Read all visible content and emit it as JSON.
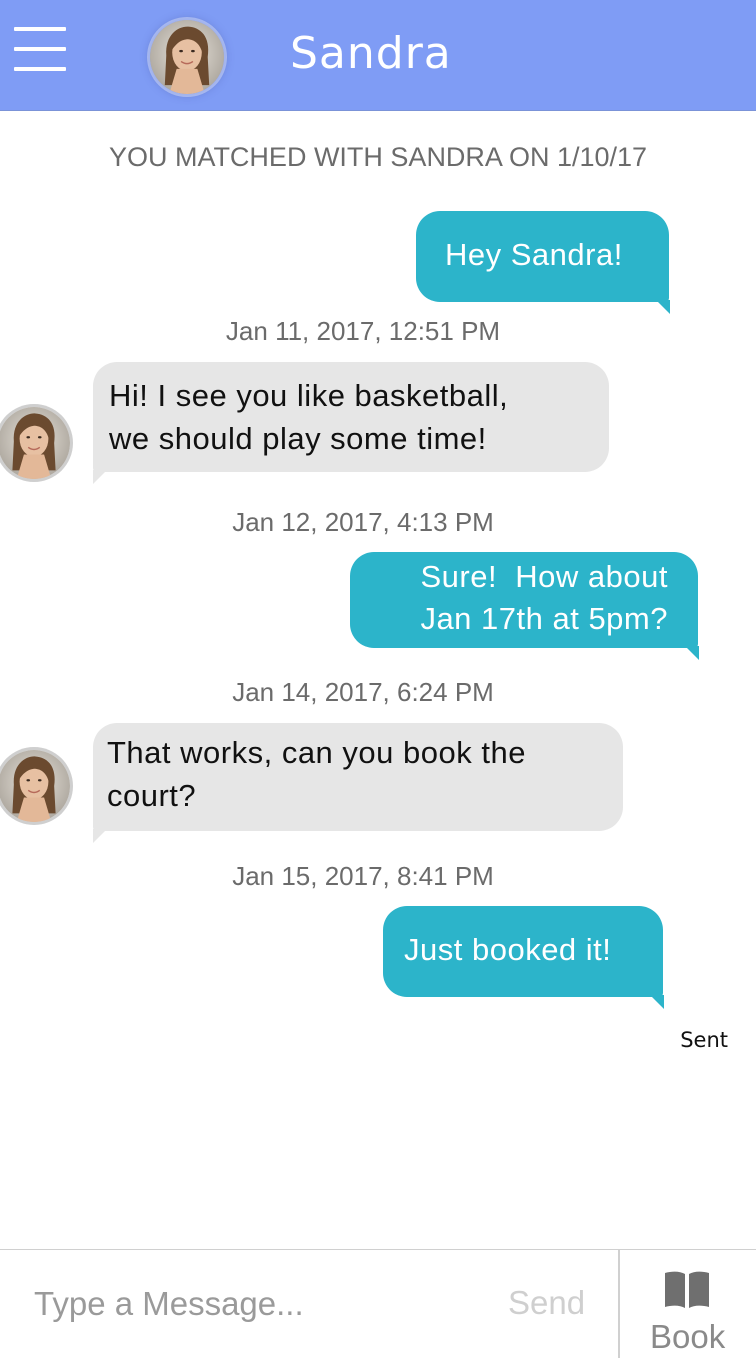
{
  "header": {
    "title": "Sandra",
    "background_color": "#7f9cf5",
    "menu_icon": "hamburger-menu-icon"
  },
  "match_banner": "YOU MATCHED WITH SANDRA ON 1/10/17",
  "messages": [
    {
      "direction": "outgoing",
      "text": "Hey Sandra!"
    },
    {
      "direction": "incoming",
      "timestamp": "Jan 11, 2017, 12:51 PM",
      "lines": [
        "Hi! I see you like basketball,",
        "we should play some time!"
      ]
    },
    {
      "direction": "outgoing",
      "timestamp": "Jan 12, 2017, 4:13 PM",
      "lines": [
        "Sure!  How about",
        "Jan 17th at 5pm?"
      ]
    },
    {
      "direction": "incoming",
      "timestamp": "Jan 14, 2017, 6:24 PM",
      "lines": [
        "That works, can you book the",
        "court?"
      ]
    },
    {
      "direction": "outgoing",
      "timestamp": "Jan 15, 2017, 8:41 PM",
      "text": "Just booked it!"
    }
  ],
  "sent_status": "Sent",
  "composer": {
    "placeholder": "Type a Message...",
    "value": "",
    "send_label": "Send",
    "book_label": "Book",
    "book_icon": "open-book-icon"
  },
  "colors": {
    "outgoing_bubble": "#2cb4ca",
    "incoming_bubble": "#e6e6e6"
  }
}
